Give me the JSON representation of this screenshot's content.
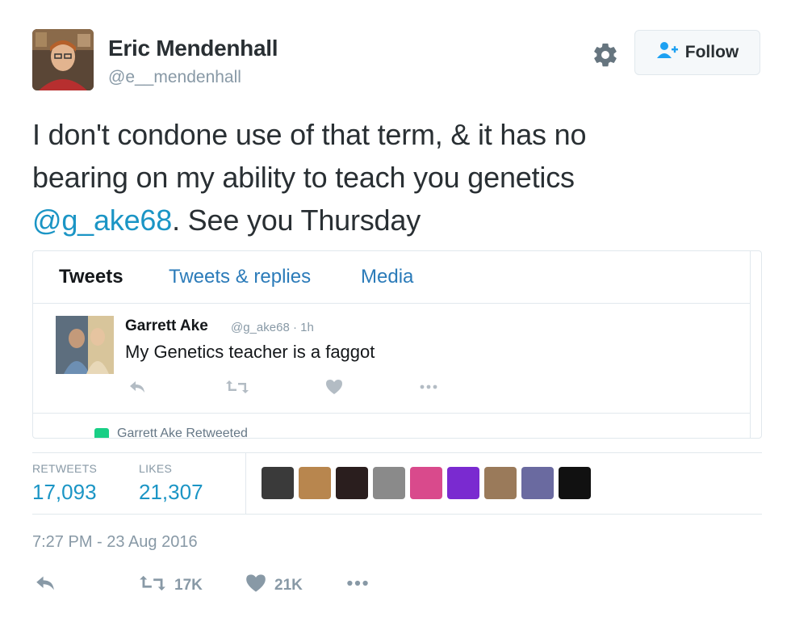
{
  "author": {
    "name": "Eric Mendenhall",
    "handle": "@e__mendenhall"
  },
  "follow": {
    "label": "Follow"
  },
  "tweet": {
    "line1": "I don't condone use of that term, & it has no",
    "line2": "bearing on my ability to teach you genetics",
    "mention": "@g_ake68",
    "line3_rest": ". See you Thursday"
  },
  "embedded": {
    "tabs": [
      "Tweets",
      "Tweets & replies",
      "Media"
    ],
    "tweet": {
      "name": "Garrett Ake",
      "meta": "@g_ake68 · 1h",
      "text": "My Genetics teacher is a faggot"
    },
    "retweeted_by": "Garrett Ake Retweeted"
  },
  "stats": {
    "retweets_label": "RETWEETS",
    "retweets_value": "17,093",
    "likes_label": "LIKES",
    "likes_value": "21,307"
  },
  "likers": [
    {
      "color": "#3a3a3a"
    },
    {
      "color": "#b8864e"
    },
    {
      "color": "#2a1e1e"
    },
    {
      "color": "#8a8a8a"
    },
    {
      "color": "#d94a8c"
    },
    {
      "color": "#7a2ad0"
    },
    {
      "color": "#9a7a5a"
    },
    {
      "color": "#6a6aa0"
    },
    {
      "color": "#111111"
    }
  ],
  "timestamp": "7:27 PM - 23 Aug 2016",
  "footer": {
    "retweet_count": "17K",
    "like_count": "21K"
  },
  "colors": {
    "accent": "#1b95c5",
    "muted": "#8899a6",
    "text": "#292f33"
  }
}
